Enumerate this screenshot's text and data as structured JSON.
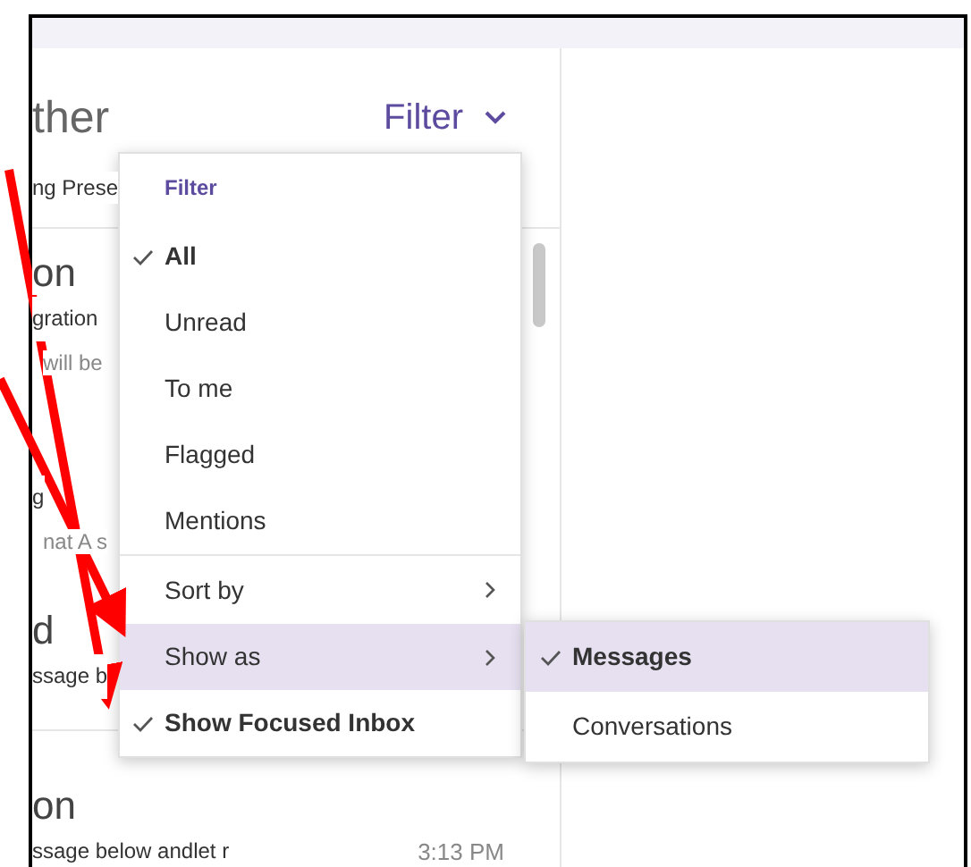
{
  "header": {
    "title": "ther",
    "filter_button": "Filter",
    "subtitle": "ng Prese"
  },
  "messages": [
    {
      "sender": "on",
      "subject": "gration",
      "preview": "will be"
    },
    {
      "subject": "g",
      "preview": "nat  A s"
    },
    {
      "sender": "d",
      "subject": "ssage b"
    },
    {
      "sender": "on",
      "subject": "ssage below andlet r",
      "time": "3:13 PM"
    }
  ],
  "filter_menu": {
    "heading": "Filter",
    "items": [
      {
        "kind": "option",
        "label": "All",
        "checked": true,
        "selected": false
      },
      {
        "kind": "option",
        "label": "Unread",
        "checked": false,
        "selected": false
      },
      {
        "kind": "option",
        "label": "To me",
        "checked": false,
        "selected": false
      },
      {
        "kind": "option",
        "label": "Flagged",
        "checked": false,
        "selected": false
      },
      {
        "kind": "option",
        "label": "Mentions",
        "checked": false,
        "selected": false
      },
      {
        "kind": "submenu",
        "label": "Sort by",
        "checked": false,
        "selected": false
      },
      {
        "kind": "submenu",
        "label": "Show as",
        "checked": false,
        "selected": true
      },
      {
        "kind": "toggle",
        "label": "Show Focused Inbox",
        "checked": true,
        "selected": false
      }
    ]
  },
  "show_as_menu": [
    {
      "label": "Messages",
      "checked": true,
      "selected": true
    },
    {
      "label": "Conversations",
      "checked": false,
      "selected": false
    }
  ]
}
